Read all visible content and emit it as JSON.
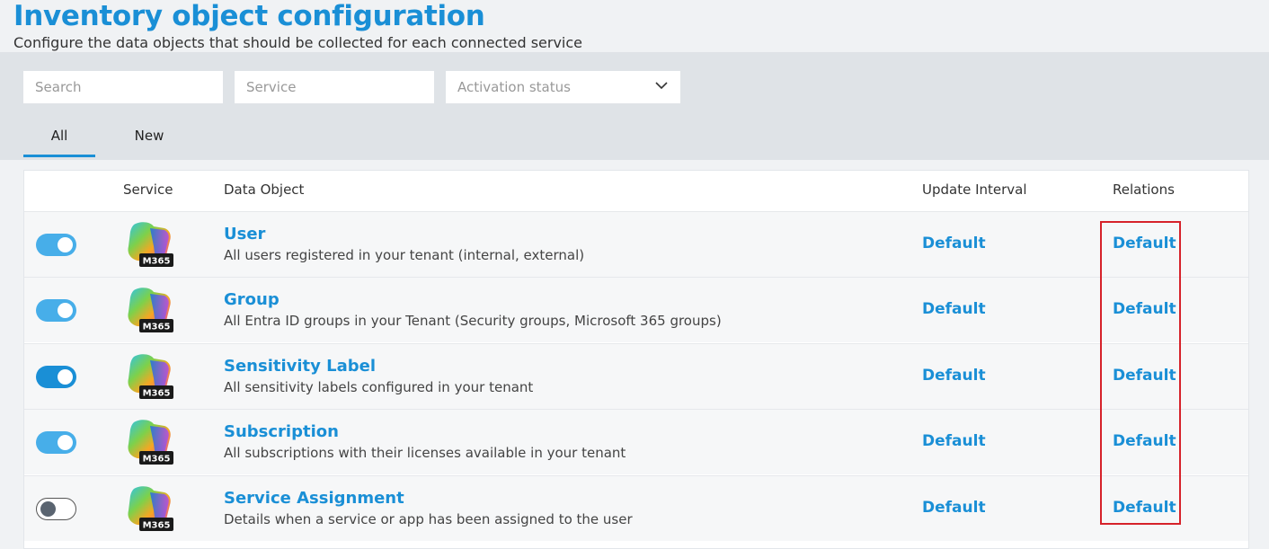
{
  "header": {
    "title": "Inventory object configuration",
    "subtitle": "Configure the data objects that should be collected for each connected service"
  },
  "filters": {
    "search_placeholder": "Search",
    "service_placeholder": "Service",
    "status_placeholder": "Activation status"
  },
  "tabs": [
    {
      "label": "All",
      "active": true
    },
    {
      "label": "New",
      "active": false
    }
  ],
  "table": {
    "columns": {
      "service": "Service",
      "data_object": "Data Object",
      "update_interval": "Update Interval",
      "relations": "Relations"
    },
    "rows": [
      {
        "enabled": true,
        "service_badge": "M365",
        "name": "User",
        "description": "All users registered in your tenant (internal, external)",
        "update_interval": "Default",
        "relations": "Default"
      },
      {
        "enabled": true,
        "service_badge": "M365",
        "name": "Group",
        "description": "All Entra ID groups in your Tenant (Security groups, Microsoft 365 groups)",
        "update_interval": "Default",
        "relations": "Default"
      },
      {
        "enabled": true,
        "service_badge": "M365",
        "name": "Sensitivity Label",
        "description": "All sensitivity labels configured in your tenant",
        "update_interval": "Default",
        "relations": "Default"
      },
      {
        "enabled": true,
        "service_badge": "M365",
        "name": "Subscription",
        "description": "All subscriptions with their licenses available in your tenant",
        "update_interval": "Default",
        "relations": "Default"
      },
      {
        "enabled": false,
        "service_badge": "M365",
        "name": "Service Assignment",
        "description": "Details when a service or app has been assigned to the user",
        "update_interval": "Default",
        "relations": "Default"
      }
    ]
  },
  "colors": {
    "accent": "#1a8fd6",
    "highlight": "#d6222a"
  },
  "icons": {
    "service": "microsoft-365-icon",
    "dropdown": "chevron-down-icon"
  }
}
